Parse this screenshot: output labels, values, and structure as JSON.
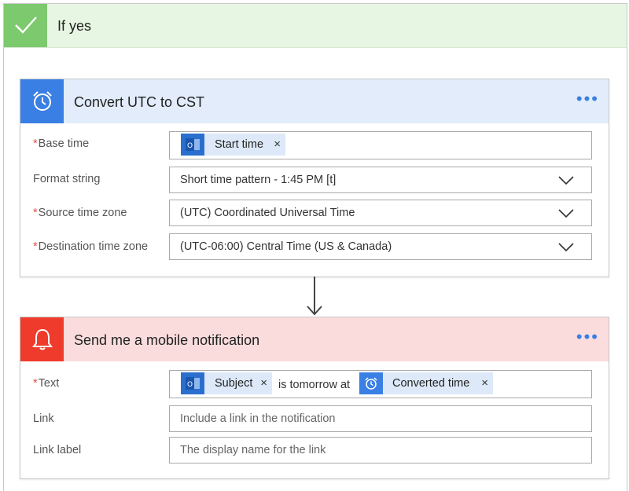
{
  "branch": {
    "title": "If yes",
    "header_color": "#e7f6e2",
    "check_color": "#7cc96e"
  },
  "convert_card": {
    "title": "Convert UTC to CST",
    "more": "•••",
    "header_color": "#e2ecfb",
    "icon_color": "#3a7fe4",
    "icon": "alarm-clock-icon",
    "fields": {
      "base_time": {
        "label": "Base time",
        "required": "*",
        "token": "Start time",
        "token_icon": "outlook-icon",
        "remove": "×"
      },
      "format_string": {
        "label": "Format string",
        "value": "Short time pattern - 1:45 PM [t]"
      },
      "source_tz": {
        "label": "Source time zone",
        "required": "*",
        "value": "(UTC) Coordinated Universal Time"
      },
      "dest_tz": {
        "label": "Destination time zone",
        "required": "*",
        "value": "(UTC-06:00) Central Time (US & Canada)"
      }
    }
  },
  "notify_card": {
    "title": "Send me a mobile notification",
    "more": "•••",
    "header_color": "#fbdcdc",
    "icon_color": "#ee3b2c",
    "icon": "bell-icon",
    "fields": {
      "text": {
        "label": "Text",
        "required": "*",
        "token1": "Subject",
        "token1_icon": "outlook-icon",
        "middle": "is tomorrow at",
        "token2": "Converted time",
        "token2_icon": "alarm-clock-icon",
        "remove": "×"
      },
      "link": {
        "label": "Link",
        "placeholder": "Include a link in the notification"
      },
      "link_label": {
        "label": "Link label",
        "placeholder": "The display name for the link"
      }
    }
  }
}
